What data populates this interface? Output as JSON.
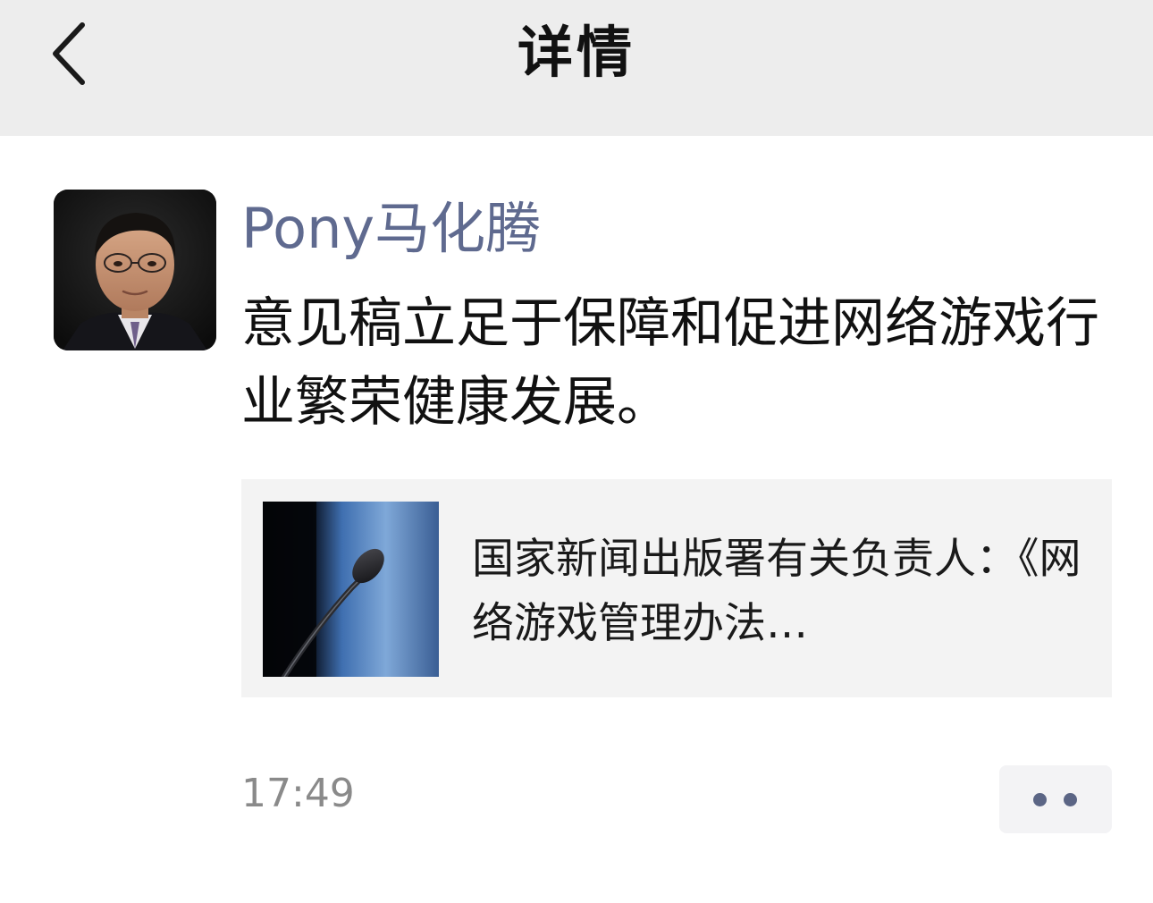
{
  "header": {
    "title": "详情",
    "back_icon": "chevron-left-icon"
  },
  "post": {
    "author": "Pony马化腾",
    "text": "意见稿立足于保障和促进网络游戏行业繁荣健康发展。",
    "avatar_icon": "profile-photo",
    "link_card": {
      "title": "国家新闻出版署有关负责人：《网络游戏管理办法…",
      "thumbnail": "microphone-photo"
    },
    "time": "17:49",
    "more_icon": "more-dots-icon"
  },
  "colors": {
    "header_bg": "#ededed",
    "author_name": "#5f6a8f",
    "card_bg": "#f3f3f3",
    "timestamp": "#8a8a8a"
  }
}
